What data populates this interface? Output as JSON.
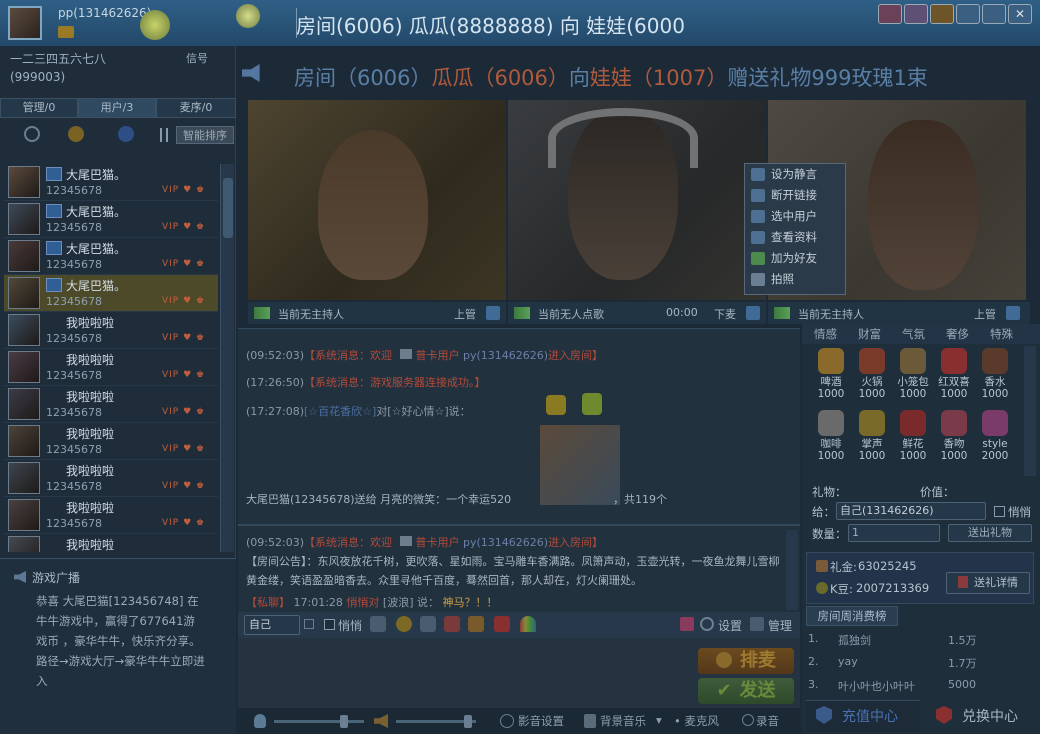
{
  "window": {
    "user": "pp(131462626)",
    "room_title": "房间(6006) 瓜瓜(8888888) 向 娃娃(6000"
  },
  "left_panel": {
    "room_name": "一二三四五六七八",
    "room_id": "(999003)",
    "signal": "信号",
    "tabs": [
      "管理/0",
      "用户/3",
      "麦序/0"
    ],
    "sort_button": "智能排序",
    "users": [
      {
        "name": "大尾巴猫。",
        "id": "12345678",
        "badges": "VIP ♥ ♚"
      },
      {
        "name": "大尾巴猫。",
        "id": "12345678",
        "badges": "VIP ♥ ♚"
      },
      {
        "name": "大尾巴猫。",
        "id": "12345678",
        "badges": "VIP ♥ ♚"
      },
      {
        "name": "大尾巴猫。",
        "id": "12345678",
        "badges": "VIP ♥ ♚"
      },
      {
        "name": "我啦啦啦",
        "id": "12345678",
        "badges": "VIP ♥ ♚"
      },
      {
        "name": "我啦啦啦",
        "id": "12345678",
        "badges": "VIP ♥ ♚"
      },
      {
        "name": "我啦啦啦",
        "id": "12345678",
        "badges": "VIP ♥ ♚"
      },
      {
        "name": "我啦啦啦",
        "id": "12345678",
        "badges": "VIP ♥ ♚"
      },
      {
        "name": "我啦啦啦",
        "id": "12345678",
        "badges": "VIP ♥ ♚"
      },
      {
        "name": "我啦啦啦",
        "id": "12345678",
        "badges": "VIP ♥ ♚"
      },
      {
        "name": "我啦啦啦",
        "id": "",
        "badges": ""
      }
    ],
    "game_broadcast": {
      "title": "游戏广播",
      "text": "恭喜 大尾巴猫[123456748] 在牛牛游戏中，赢得了677641游戏币 ，豪华牛牛，快乐齐分享。路径→游戏大厅→豪华牛牛立即进入"
    }
  },
  "center": {
    "banner": {
      "p1": "房间（6006）",
      "p2": "瓜瓜（6006）",
      "p3": "向",
      "p4": "娃娃（1007）",
      "p5": "赠送礼物999玫瑰1束"
    },
    "video_bars": [
      {
        "label": "当前无主持人",
        "action": "上管"
      },
      {
        "label": "当前无人点歌",
        "time": "00:00",
        "action": "下麦"
      },
      {
        "label": "当前无主持人",
        "action": "上管"
      }
    ],
    "context_menu": [
      "设为静言",
      "断开链接",
      "选中用户",
      "查看资料",
      "加为好友",
      "拍照"
    ],
    "chat": [
      {
        "time": "(09:52:03)",
        "sys": "【系统消息：欢迎",
        "card": "普卡用户",
        "user": "py(131462626)",
        "tail": "进入房间】"
      },
      {
        "time": "(17:26:50)",
        "sys": "【系统消息：游戏服务器连接成功。】"
      },
      {
        "time": "(17:27:08)",
        "from": "[☆百花香欣☆]",
        "to": "对[☆好心情☆]",
        "said": "说："
      },
      {
        "gift_line": "大尾巴猫(12345678)送给 月亮的微笑：一个幸运520",
        "count": "，共119个"
      }
    ],
    "public_chat": {
      "line1_time": "(09:52:03)",
      "line1_sys": "【系统消息：欢迎",
      "line1_card": "普卡用户",
      "line1_user": "py(131462626)",
      "line1_tail": "进入房间】",
      "notice": "【房间公告】：东风夜放花千树，更吹落、星如雨。宝马雕车香满路。凤箫声动，玉壶光转，一夜鱼龙舞儿雪柳黄金缕，笑语盈盈暗香去。众里寻他千百度，蓦然回首，那人却在，灯火阑珊处。",
      "whisper_tag": "【私聊】",
      "whisper_time": "17:01:28",
      "whisper_from": "悄悄对",
      "whisper_to": "[波浪] 说：",
      "whisper_text": "神马？！！"
    },
    "input_bar": {
      "target": "自己",
      "whisper": "悄悄",
      "settings": "设置",
      "manage": "管理"
    },
    "send_button": "发送",
    "sort_button": "排麦",
    "bottom_bar": {
      "video_settings": "影音设置",
      "bg_music": "背景音乐",
      "mic": "麦克风",
      "record": "录音"
    }
  },
  "right_panel": {
    "gift_tabs": [
      "情感",
      "财富",
      "气氛",
      "奢侈",
      "特殊"
    ],
    "gifts": [
      {
        "name": "啤酒",
        "price": "1000"
      },
      {
        "name": "火锅",
        "price": "1000"
      },
      {
        "name": "小笼包",
        "price": "1000"
      },
      {
        "name": "红双喜",
        "price": "1000"
      },
      {
        "name": "香水",
        "price": "1000"
      },
      {
        "name": "咖啡",
        "price": "1000"
      },
      {
        "name": "掌声",
        "price": "1000"
      },
      {
        "name": "鲜花",
        "price": "1000"
      },
      {
        "name": "香吻",
        "price": "1000"
      },
      {
        "name": "style",
        "price": "2000"
      }
    ],
    "gift_label": "礼物：",
    "price_label": "价值：",
    "to_label": "给：",
    "to_value": "自己(131462626)",
    "whisper": "悄悄",
    "qty_label": "数量：",
    "qty_value": "1",
    "send_gift": "送出礼物",
    "gold_label": "礼金:",
    "gold_value": "63025245",
    "kdou_label": "K豆:",
    "kdou_value": "2007213369",
    "gift_detail": "送礼详情",
    "weekly_tab": "房间周消费榜",
    "ranks": [
      {
        "rank": "1.",
        "name": "孤独剑",
        "amount": "1.5万"
      },
      {
        "rank": "2.",
        "name": "yay",
        "amount": "1.7万"
      },
      {
        "rank": "3.",
        "name": "叶小叶也小叶叶",
        "amount": "5000"
      }
    ],
    "recharge": "充值中心",
    "exchange": "兑换中心"
  }
}
